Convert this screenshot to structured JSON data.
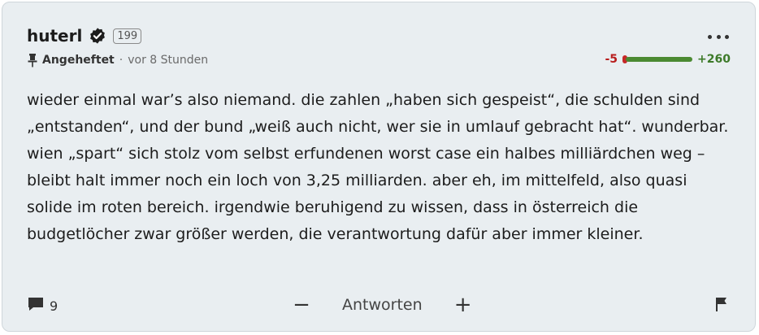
{
  "post": {
    "username": "huterl",
    "badge": "199",
    "pinned_label": "Angeheftet",
    "separator": "·",
    "time": "vor 8 Stunden",
    "votes": {
      "negative": "-5",
      "positive": "+260",
      "positive_fraction": 0.98
    },
    "body": "wieder einmal war’s also niemand. die zahlen „haben sich gespeist“, die schulden sind „entstanden“, und der bund „weiß auch nicht, wer sie in umlauf gebracht hat“. wunderbar. wien „spart“ sich stolz vom selbst erfundenen worst case ein halbes milliärdchen weg – bleibt halt immer noch ein loch von 3,25 milliarden. aber eh, im mittelfeld, also quasi solide im roten bereich. irgendwie beruhigend zu wissen, dass in österreich die budgetlöcher zwar größer werden, die verantwortung dafür aber immer kleiner."
  },
  "footer": {
    "comment_count": "9",
    "minus": "−",
    "reply_label": "Antworten",
    "plus": "+"
  },
  "icons": {
    "verified": "verified-badge-icon",
    "more": "more-options-icon",
    "pin": "pin-icon",
    "comment": "comment-icon",
    "flag": "flag-icon"
  },
  "colors": {
    "card_background": "#e9eef1",
    "negative": "#b81d1d",
    "positive": "#3d7a29"
  }
}
